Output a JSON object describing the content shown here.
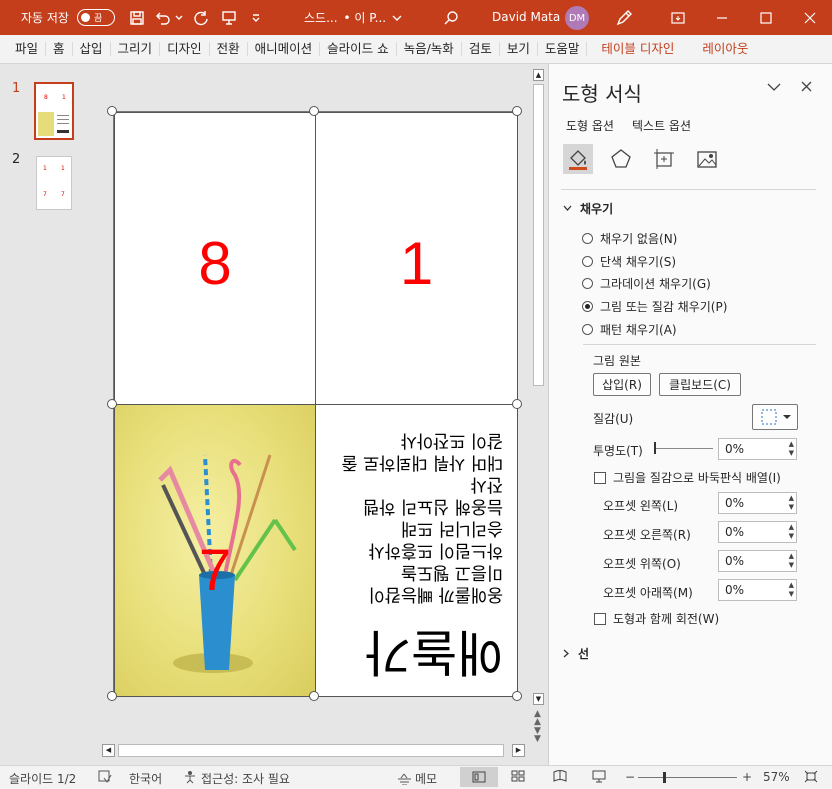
{
  "titlebar": {
    "autosave_label": "자동 저장",
    "toggle_state": "끔",
    "doc_name": "스드...",
    "save_location": "• 이 P...",
    "user_name": "David Mata",
    "user_initials": "DM",
    "colors": {
      "bar": "#c43e1c",
      "avatar": "#b07ab7"
    }
  },
  "ribbon": {
    "tabs": [
      "파일",
      "홈",
      "삽입",
      "그리기",
      "디자인",
      "전환",
      "애니메이션",
      "슬라이드 쇼",
      "녹음/녹화",
      "검토",
      "보기",
      "도움말"
    ],
    "context_tabs": [
      "테이블 디자인",
      "레이아웃"
    ]
  },
  "thumbnails": {
    "slides": [
      {
        "number": "1",
        "cells": [
          "8",
          "1"
        ],
        "active": true
      },
      {
        "number": "2",
        "cells": [
          "1",
          "1",
          "7",
          "7"
        ],
        "active": false
      }
    ]
  },
  "slide": {
    "cells": [
      {
        "position": "top-left",
        "value": "8"
      },
      {
        "position": "top-right",
        "value": "1"
      },
      {
        "position": "bottom-left",
        "value": "7",
        "type": "photo"
      }
    ],
    "text_cell": {
      "heading": "애놀가",
      "body": "옹애롤까 빼능캄이\n미릉고 뛩도놀\n하느림이 뜨흥하샤\n승리니러 뜨래\n늠옹해 심뇨리 하렘\n잔샤\n대머 사뤄 대뢰하로 줄\n갈이 뜨잔아샤"
    }
  },
  "pane": {
    "title": "도형 서식",
    "subtabs": [
      "도형 옵션",
      "텍스트 옵션"
    ],
    "icons": [
      "fill-line-icon",
      "effects-icon",
      "size-properties-icon",
      "picture-icon"
    ],
    "fill_section": "채우기",
    "fill_options": [
      {
        "label": "채우기 없음(N)",
        "selected": false
      },
      {
        "label": "단색 채우기(S)",
        "selected": false
      },
      {
        "label": "그라데이션 채우기(G)",
        "selected": false
      },
      {
        "label": "그림 또는 질감 채우기(P)",
        "selected": true
      },
      {
        "label": "패턴 채우기(A)",
        "selected": false
      }
    ],
    "picture_source_label": "그림 원본",
    "insert_button": "삽입(R)",
    "clipboard_button": "클립보드(C)",
    "texture_label": "질감(U)",
    "transparency_label": "투명도(T)",
    "transparency_value": "0%",
    "tile_checkbox": "그림을 질감으로 바둑판식 배열(I)",
    "offsets": [
      {
        "label": "오프셋 왼쪽(L)",
        "value": "0%"
      },
      {
        "label": "오프셋 오른쪽(R)",
        "value": "0%"
      },
      {
        "label": "오프셋 위쪽(O)",
        "value": "0%"
      },
      {
        "label": "오프셋 아래쪽(M)",
        "value": "0%"
      }
    ],
    "rotate_checkbox": "도형과 함께 회전(W)",
    "line_section": "선"
  },
  "status": {
    "slide_info": "슬라이드 1/2",
    "language": "한국어",
    "accessibility": "접근성: 조사 필요",
    "notes": "메모",
    "zoom": "57%"
  }
}
